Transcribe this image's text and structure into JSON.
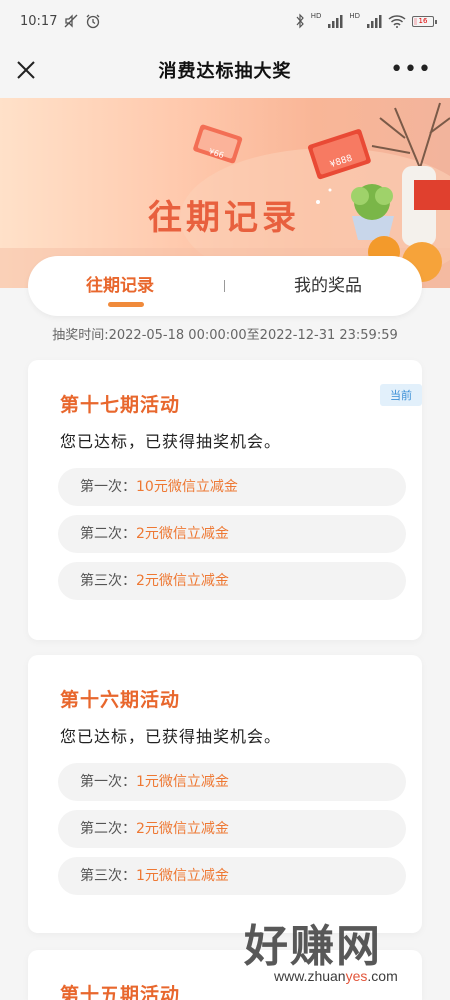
{
  "status_bar": {
    "time": "10:17",
    "net1": "HD",
    "net2": "HD",
    "battery": "16"
  },
  "nav": {
    "title": "消费达标抽大奖",
    "more": "•••"
  },
  "banner": {
    "title": "往期记录",
    "coupon_small": "¥66",
    "coupon_large": "¥888"
  },
  "tabs": [
    {
      "label": "往期记录",
      "active": true
    },
    {
      "label": "我的奖品",
      "active": false
    }
  ],
  "time_range": "抽奖时间:2022-05-18 00:00:00至2022-12-31 23:59:59",
  "cards": [
    {
      "title": "第十七期活动",
      "status": "您已达标，已获得抽奖机会。",
      "badge": "当前",
      "prizes": [
        {
          "label": "第一次：",
          "value": "10元微信立减金"
        },
        {
          "label": "第二次：",
          "value": "2元微信立减金"
        },
        {
          "label": "第三次：",
          "value": "2元微信立减金"
        }
      ]
    },
    {
      "title": "第十六期活动",
      "status": "您已达标，已获得抽奖机会。",
      "prizes": [
        {
          "label": "第一次：",
          "value": "1元微信立减金"
        },
        {
          "label": "第二次：",
          "value": "2元微信立减金"
        },
        {
          "label": "第三次：",
          "value": "1元微信立减金"
        }
      ]
    },
    {
      "title": "第十五期活动"
    }
  ],
  "watermark": {
    "text": "好赚网",
    "url_pre": "www.zhuan",
    "url_hl": "yes",
    "url_post": ".com"
  }
}
